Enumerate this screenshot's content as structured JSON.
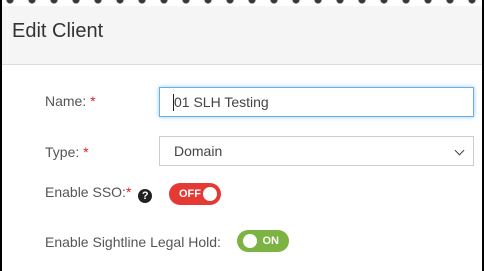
{
  "dialog": {
    "title": "Edit Client"
  },
  "form": {
    "name_label": "Name:",
    "name_required": "*",
    "name_value": "01 SLH Testing",
    "type_label": "Type:",
    "type_required": "*",
    "type_value": "Domain",
    "sso_label": "Enable SSO:",
    "sso_required": "*",
    "sso_help_icon": "?",
    "sso_toggle": "OFF",
    "legal_hold_label": "Enable Sightline Legal Hold:",
    "legal_hold_toggle": "ON"
  },
  "colors": {
    "toggle_off": "#e53935",
    "toggle_on": "#7cb342",
    "required": "#e02020"
  },
  "icons": {
    "help": "question-circle-icon",
    "dropdown": "chevron-down-icon"
  }
}
